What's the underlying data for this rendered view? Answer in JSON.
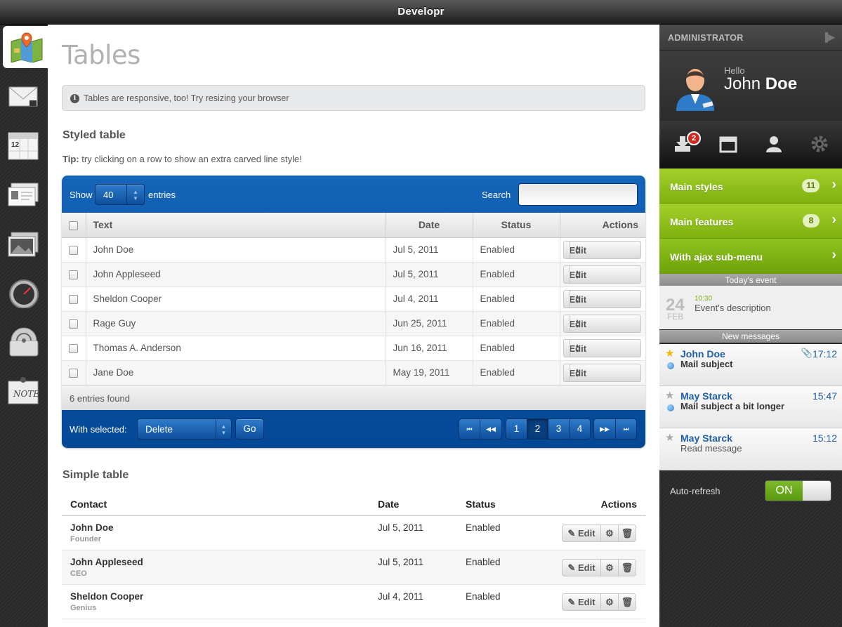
{
  "app": {
    "title": "Developr"
  },
  "page": {
    "title": "Tables",
    "info": "Tables are responsive, too! Try resizing your browser"
  },
  "styled_table": {
    "heading": "Styled table",
    "tip_label": "Tip:",
    "tip_text": "try clicking on a row to show an extra carved line style!",
    "show_label": "Show",
    "show_value": "40",
    "entries_label": "entries",
    "search_label": "Search",
    "search_value": "",
    "columns": [
      "Text",
      "Date",
      "Status",
      "Actions"
    ],
    "rows": [
      {
        "text": "John Doe",
        "date": "Jul 5, 2011",
        "status": "Enabled",
        "action": "Edit"
      },
      {
        "text": "John Appleseed",
        "date": "Jul 5, 2011",
        "status": "Enabled",
        "action": "Edit"
      },
      {
        "text": "Sheldon Cooper",
        "date": "Jul 4, 2011",
        "status": "Enabled",
        "action": "Edit"
      },
      {
        "text": "Rage Guy",
        "date": "Jun 25, 2011",
        "status": "Enabled",
        "action": "Edit"
      },
      {
        "text": "Thomas A. Anderson",
        "date": "Jun 16, 2011",
        "status": "Enabled",
        "action": "Edit"
      },
      {
        "text": "Jane Doe",
        "date": "May 19, 2011",
        "status": "Enabled",
        "action": "Edit"
      }
    ],
    "found": "6 entries found",
    "with_selected_label": "With selected:",
    "with_selected_value": "Delete",
    "go_label": "Go",
    "pagination": {
      "pages": [
        "1",
        "2",
        "3",
        "4"
      ],
      "current": "2",
      "first": "⏮",
      "prev": "◀◀",
      "next": "▶▶",
      "last": "⏭"
    }
  },
  "simple_table": {
    "heading": "Simple table",
    "columns": [
      "Contact",
      "Date",
      "Status",
      "Actions"
    ],
    "edit_label": "Edit",
    "rows": [
      {
        "name": "John Doe",
        "role": "Founder",
        "date": "Jul 5, 2011",
        "status": "Enabled"
      },
      {
        "name": "John Appleseed",
        "role": "CEO",
        "date": "Jul 5, 2011",
        "status": "Enabled"
      },
      {
        "name": "Sheldon Cooper",
        "role": "Genius",
        "date": "Jul 4, 2011",
        "status": "Enabled"
      }
    ]
  },
  "sidebar": {
    "role": "ADMINISTRATOR",
    "hello": "Hello",
    "first_name": "John",
    "last_name": "Doe",
    "inbox_badge": "2",
    "menu": [
      {
        "label": "Main styles",
        "count": "11"
      },
      {
        "label": "Main features",
        "count": "8"
      },
      {
        "label": "With ajax sub-menu",
        "count": ""
      }
    ],
    "event_header": "Today's event",
    "event": {
      "day": "24",
      "month": "FEB",
      "time": "10:30",
      "description": "Event's description"
    },
    "messages_header": "New messages",
    "messages": [
      {
        "from": "John Doe",
        "subject": "Mail subject",
        "time": "17:12",
        "starred": true,
        "unread": true,
        "attachment": true
      },
      {
        "from": "May Starck",
        "subject": "Mail subject a bit longer",
        "time": "15:47",
        "starred": false,
        "unread": true,
        "attachment": false
      },
      {
        "from": "May Starck",
        "subject": "Read message",
        "time": "15:12",
        "starred": false,
        "unread": false,
        "attachment": false
      }
    ],
    "autorefresh_label": "Auto-refresh",
    "autorefresh_state": "ON"
  },
  "colors": {
    "accent_blue": "#034896",
    "menu_green": "#8ebf19",
    "badge_red": "#d12a1c"
  },
  "icons": [
    "map-icon",
    "mail-icon",
    "calendar-icon",
    "contacts-icon",
    "gallery-icon",
    "dashboard-icon",
    "wifi-icon",
    "note-icon"
  ]
}
